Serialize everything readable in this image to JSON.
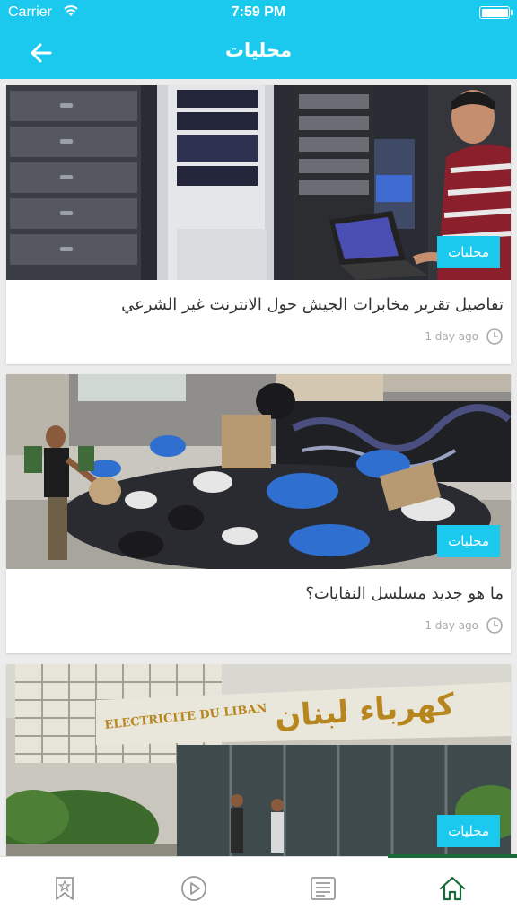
{
  "status_bar": {
    "carrier": "Carrier",
    "time": "7:59 PM",
    "battery": 1.0
  },
  "header": {
    "title": "محليات",
    "back_icon": "arrow-left-icon"
  },
  "articles": [
    {
      "image": "server-rack-photo",
      "category": "محليات",
      "title": "تفاصيل تقرير مخابرات الجيش حول الانترنت غير الشرعي",
      "time": "1 day ago"
    },
    {
      "image": "garbage-street-photo",
      "category": "محليات",
      "title": "ما هو جديد مسلسل النفايات؟",
      "time": "1 day ago"
    },
    {
      "image": "electricite-du-liban-building-photo",
      "category": "محليات",
      "image_text": [
        "ELECTRICITE DU LIBAN",
        "كهرباء لبنان"
      ]
    }
  ],
  "tab_bar": {
    "tabs": [
      "bookmark-icon",
      "play-icon",
      "news-icon",
      "home-icon"
    ],
    "active": "home-icon"
  },
  "colors": {
    "primary": "#1bc9ef",
    "active_tab": "#1b6b3a",
    "background": "#ececec"
  }
}
